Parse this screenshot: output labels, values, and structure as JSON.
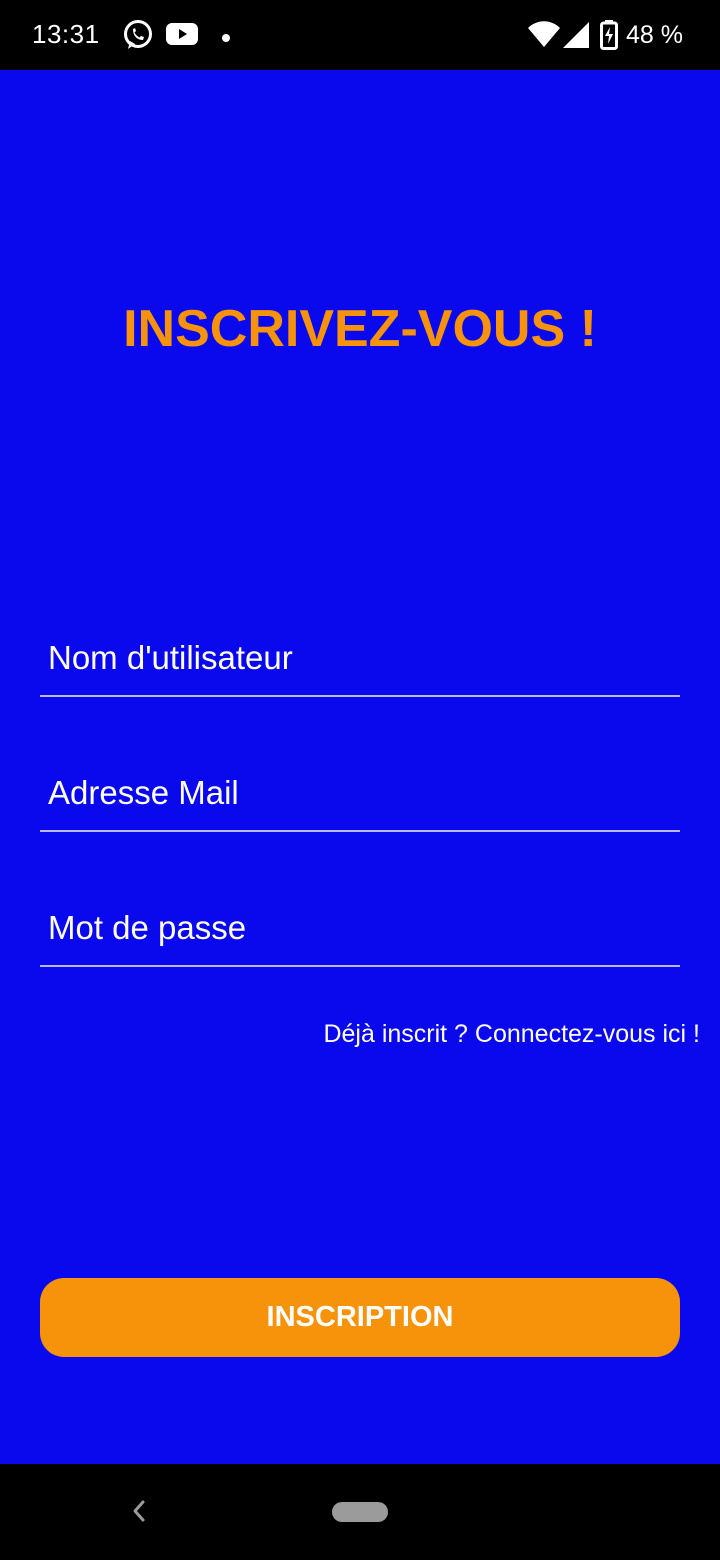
{
  "status_bar": {
    "time": "13:31",
    "battery": "48 %",
    "icons": [
      "whatsapp-icon",
      "youtube-icon",
      "notification-dot-icon",
      "wifi-icon",
      "signal-icon",
      "battery-charging-icon"
    ]
  },
  "page": {
    "title": "INSCRIVEZ-VOUS !",
    "fields": {
      "username": "Nom d'utilisateur",
      "email": "Adresse Mail",
      "password": "Mot de passe"
    },
    "login_link": "Déjà inscrit ? Connectez-vous ici !",
    "submit_label": "INSCRIPTION"
  },
  "colors": {
    "background": "#0a09ee",
    "accent": "#f7930a",
    "text": "#ffffff"
  },
  "nav_bar": {
    "icons": [
      "back-icon",
      "home-pill-icon"
    ]
  }
}
